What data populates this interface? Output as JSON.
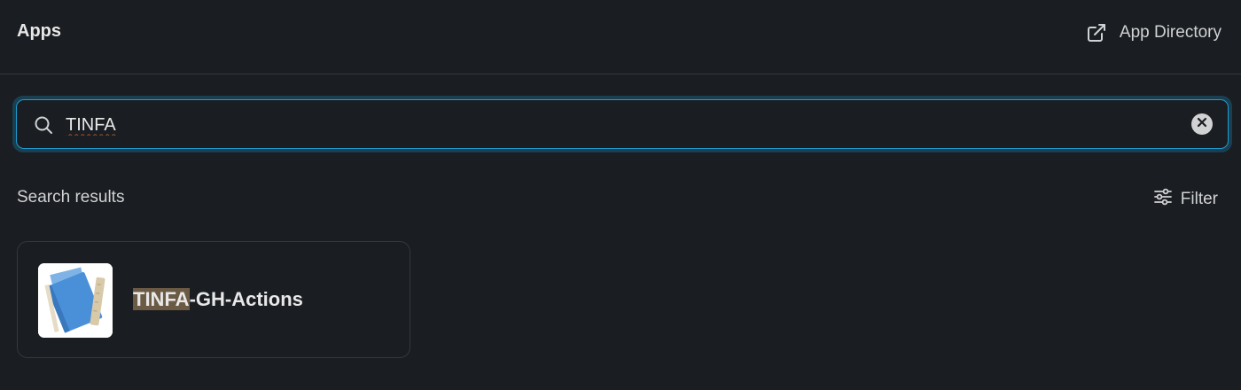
{
  "header": {
    "title": "Apps",
    "app_directory_label": "App Directory"
  },
  "search": {
    "value": "TINFA",
    "placeholder": ""
  },
  "results": {
    "label": "Search results",
    "filter_label": "Filter",
    "items": [
      {
        "highlight": "TINFA",
        "name_rest": "-GH-Actions",
        "icon": "notebook-pencil-icon"
      }
    ]
  },
  "colors": {
    "background": "#1a1d21",
    "focus_accent": "#1d9bd1",
    "highlight": "#6b5b45",
    "logo_book": "#4a90d9",
    "logo_pencil": "#d8c9a8"
  }
}
